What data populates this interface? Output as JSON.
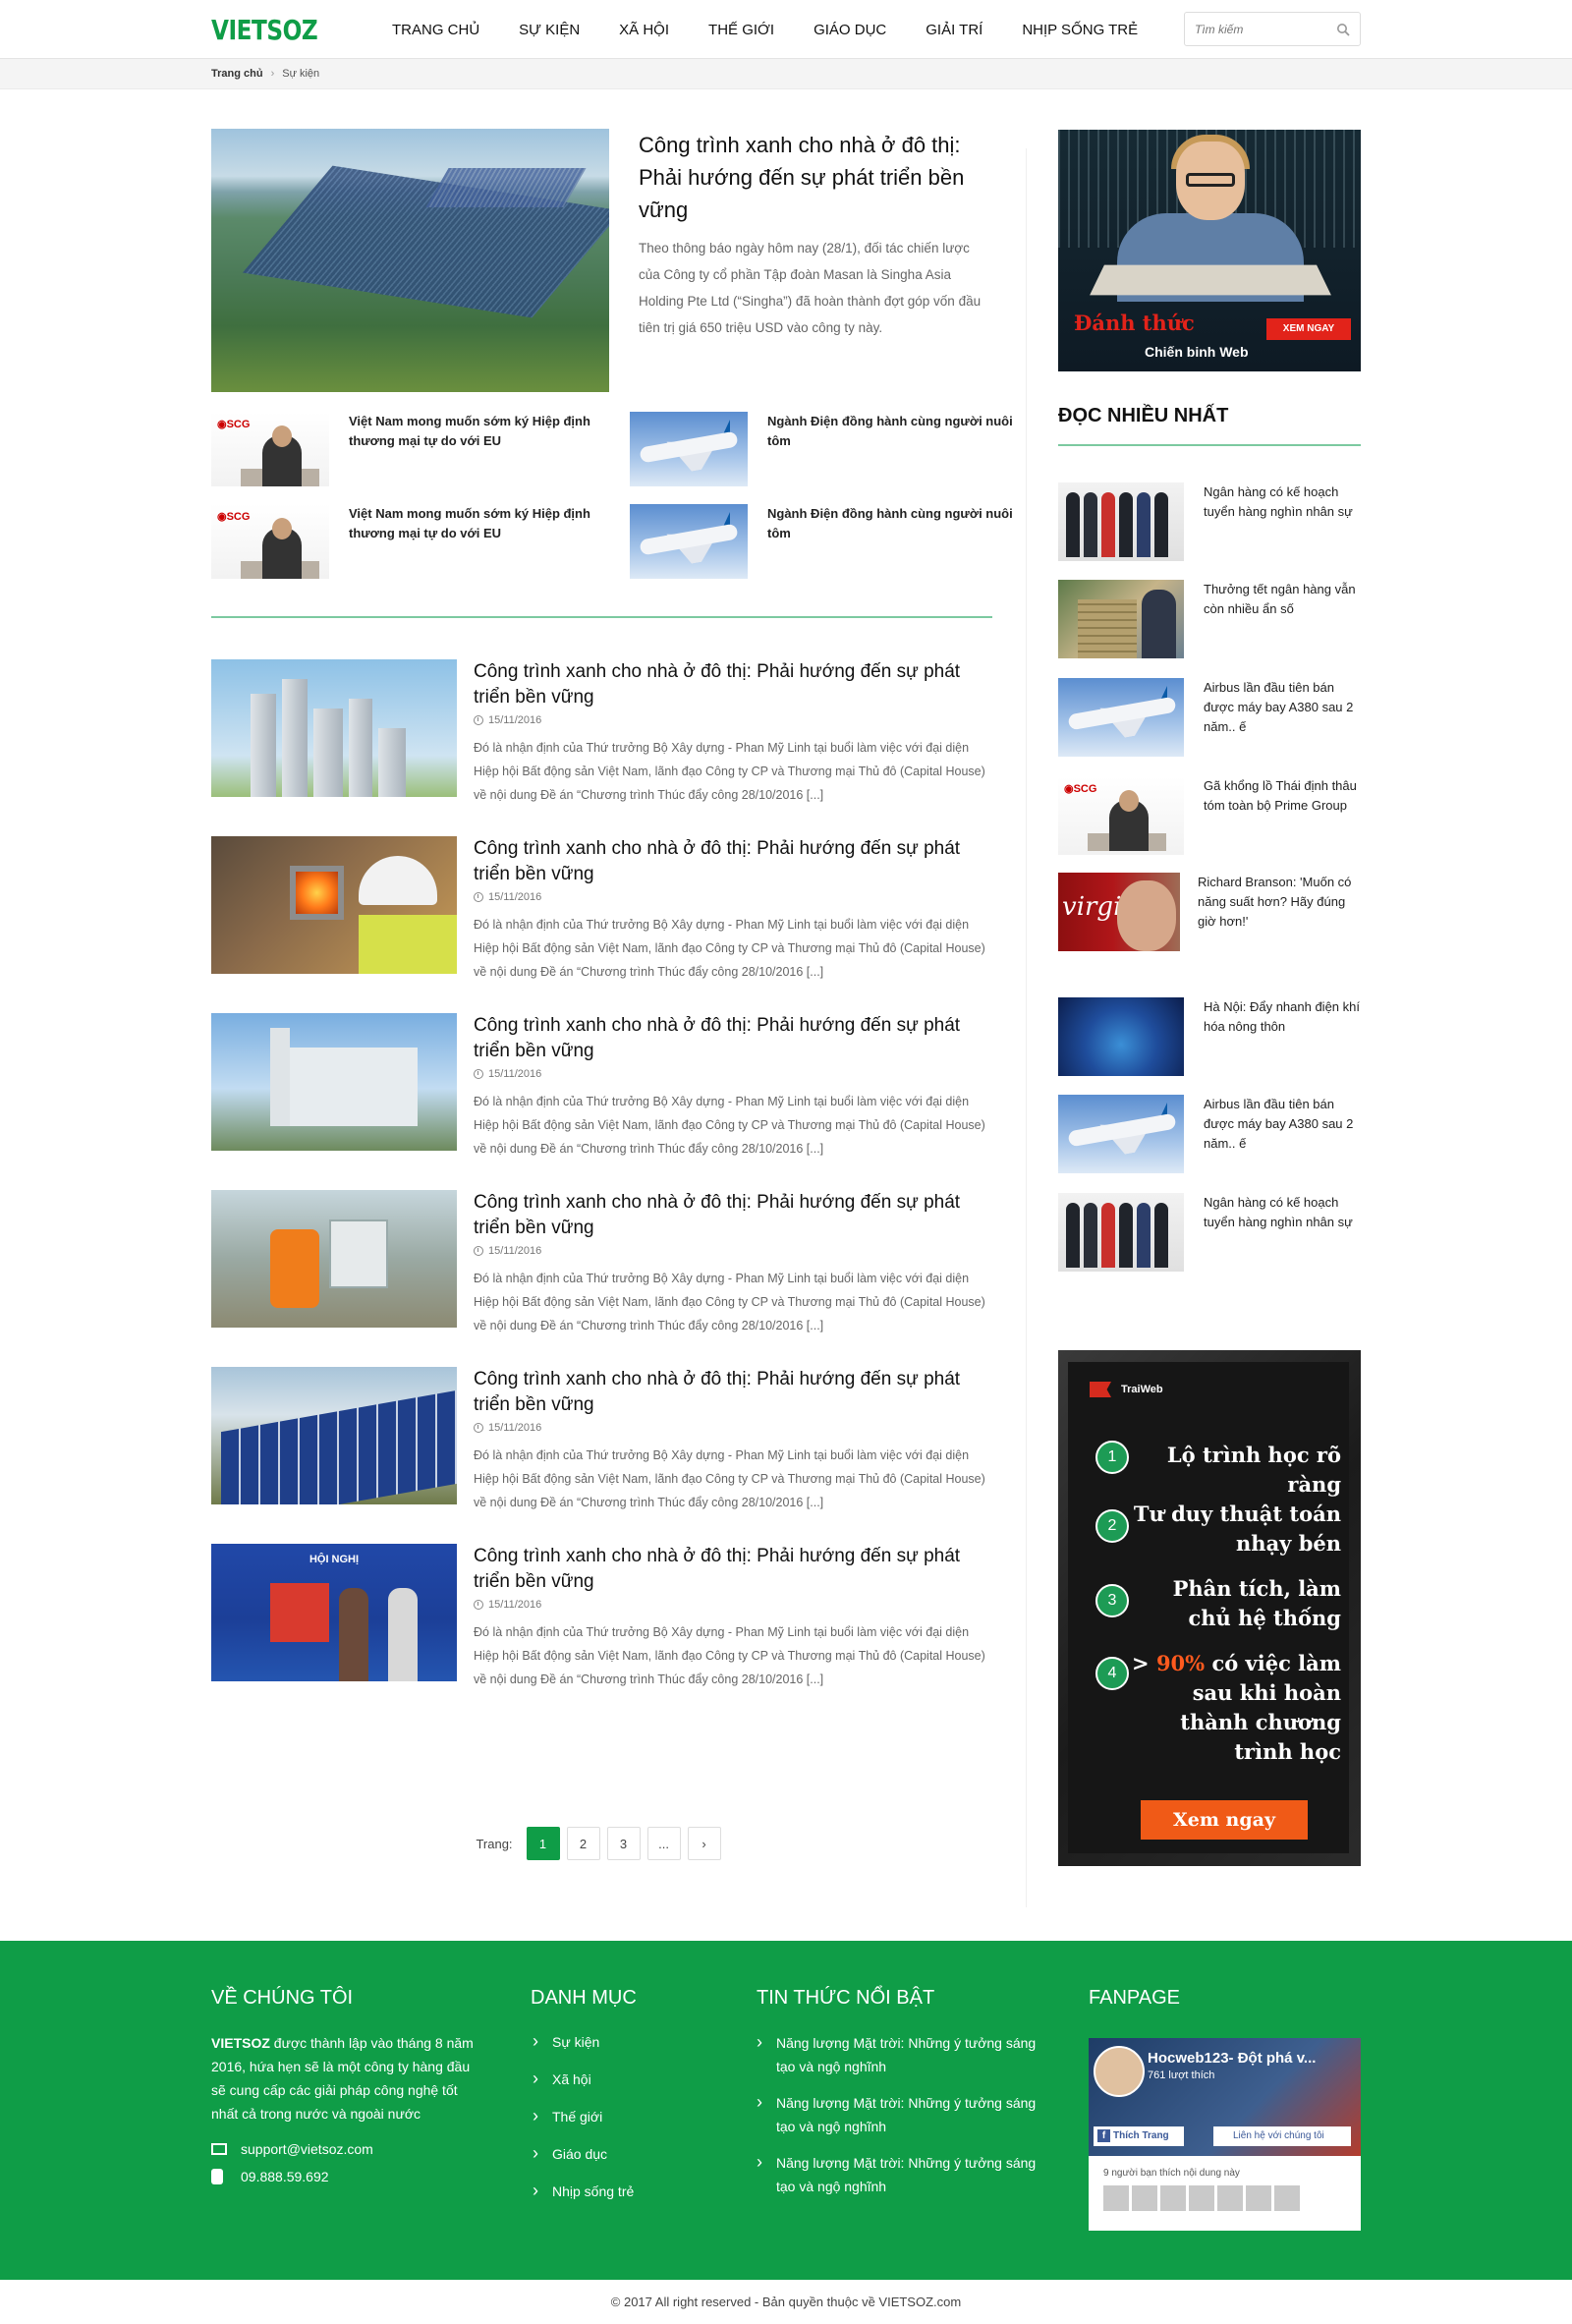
{
  "header": {
    "logo": "VIETSOZ",
    "nav": [
      "TRANG CHỦ",
      "SỰ KIỆN",
      "XÃ HỘI",
      "THẾ GIỚI",
      "GIÁO DỤC",
      "GIẢI TRÍ",
      "NHỊP SỐNG TRẺ"
    ],
    "search_placeholder": "Tìm kiếm"
  },
  "breadcrumb": {
    "home": "Trang chủ",
    "current": "Sự kiện"
  },
  "featured": {
    "title": "Công trình xanh cho nhà ở đô thị: Phải hướng đến sự phát triển bền vững",
    "desc": "Theo thông báo ngày hôm nay (28/1), đối tác chiến lược của Công ty cổ phần Tập đoàn Masan là Singha Asia Holding Pte Ltd (“Singha”) đã hoàn thành đợt góp vốn đầu tiên trị giá 650 triệu USD vào công ty này."
  },
  "small_news": [
    {
      "title": "Việt Nam mong muốn sớm ký Hiệp định thương mại tự do với EU",
      "thumb": "scg"
    },
    {
      "title": "Ngành Điện đồng hành cùng người nuôi tôm",
      "thumb": "plane"
    },
    {
      "title": "Việt Nam mong muốn sớm ký Hiệp định thương mại tự do với EU",
      "thumb": "scg"
    },
    {
      "title": "Ngành Điện đồng hành cùng người nuôi tôm",
      "thumb": "plane"
    }
  ],
  "articles": [
    {
      "title": "Công trình xanh cho nhà ở đô thị: Phải hướng đến sự phát triển bền vững",
      "date": "15/11/2016",
      "desc": "Đó là nhận định của Thứ trưởng Bộ Xây dựng - Phan Mỹ Linh tại buổi làm việc với đại diện Hiệp hội Bất động sản Việt Nam, lãnh đạo Công ty CP và Thương mại Thủ đô (Capital House) về nội dung Đề án “Chương trình Thúc đẩy công 28/10/2016 [...]"
    },
    {
      "title": "Công trình xanh cho nhà ở đô thị: Phải hướng đến sự phát triển bền vững",
      "date": "15/11/2016",
      "desc": "Đó là nhận định của Thứ trưởng Bộ Xây dựng - Phan Mỹ Linh tại buổi làm việc với đại diện Hiệp hội Bất động sản Việt Nam, lãnh đạo Công ty CP và Thương mại Thủ đô (Capital House) về nội dung Đề án “Chương trình Thúc đẩy công 28/10/2016 [...]"
    },
    {
      "title": "Công trình xanh cho nhà ở đô thị: Phải hướng đến sự phát triển bền vững",
      "date": "15/11/2016",
      "desc": "Đó là nhận định của Thứ trưởng Bộ Xây dựng - Phan Mỹ Linh tại buổi làm việc với đại diện Hiệp hội Bất động sản Việt Nam, lãnh đạo Công ty CP và Thương mại Thủ đô (Capital House) về nội dung Đề án “Chương trình Thúc đẩy công 28/10/2016 [...]"
    },
    {
      "title": "Công trình xanh cho nhà ở đô thị: Phải hướng đến sự phát triển bền vững",
      "date": "15/11/2016",
      "desc": "Đó là nhận định của Thứ trưởng Bộ Xây dựng - Phan Mỹ Linh tại buổi làm việc với đại diện Hiệp hội Bất động sản Việt Nam, lãnh đạo Công ty CP và Thương mại Thủ đô (Capital House) về nội dung Đề án “Chương trình Thúc đẩy công 28/10/2016 [...]"
    },
    {
      "title": "Công trình xanh cho nhà ở đô thị: Phải hướng đến sự phát triển bền vững",
      "date": "15/11/2016",
      "desc": "Đó là nhận định của Thứ trưởng Bộ Xây dựng - Phan Mỹ Linh tại buổi làm việc với đại diện Hiệp hội Bất động sản Việt Nam, lãnh đạo Công ty CP và Thương mại Thủ đô (Capital House) về nội dung Đề án “Chương trình Thúc đẩy công 28/10/2016 [...]"
    },
    {
      "title": "Công trình xanh cho nhà ở đô thị: Phải hướng đến sự phát triển bền vững",
      "date": "15/11/2016",
      "desc": "Đó là nhận định của Thứ trưởng Bộ Xây dựng - Phan Mỹ Linh tại buổi làm việc với đại diện Hiệp hội Bất động sản Việt Nam, lãnh đạo Công ty CP và Thương mại Thủ đô (Capital House) về nội dung Đề án “Chương trình Thúc đẩy công 28/10/2016 [...]"
    }
  ],
  "article_image_banner": "HỘI NGHỊ",
  "pagination": {
    "label": "Trang:",
    "pages": [
      "1",
      "2",
      "3",
      "...",
      "›"
    ],
    "active": "1"
  },
  "sidebar": {
    "ad_top": {
      "headline": "Đánh thức",
      "sub": "Chiến binh Web",
      "button": "XEM NGAY"
    },
    "popular_heading": "ĐỌC NHIỀU NHẤT",
    "popular": [
      {
        "title": "Ngân hàng có kế hoạch tuyển hàng nghìn nhân sự",
        "thumb": "people"
      },
      {
        "title": "Thưởng tết ngân hàng vẫn còn nhiều ẩn số",
        "thumb": "money"
      },
      {
        "title": "Airbus lần đầu tiên bán được máy bay A380 sau 2 năm.. ế",
        "thumb": "plane"
      },
      {
        "title": "Gã khổng lồ Thái định thâu tóm toàn bộ Prime Group",
        "thumb": "scg"
      },
      {
        "title": "Richard Branson: 'Muốn có năng suất hơn? Hãy đúng giờ hơn!'",
        "thumb": "virgin"
      },
      {
        "title": "Hà Nội: Đẩy nhanh điện khí hóa nông thôn",
        "thumb": "earth"
      },
      {
        "title": "Airbus lần đầu tiên bán được máy bay A380 sau 2 năm.. ế",
        "thumb": "plane"
      },
      {
        "title": "Ngân hàng có kế hoạch tuyển hàng nghìn nhân sự",
        "thumb": "people"
      }
    ],
    "ad_bottom": {
      "brand": "TraiWeb",
      "steps": [
        {
          "num": "1",
          "text": "Lộ trình học rõ ràng"
        },
        {
          "num": "2",
          "text": "Tư duy thuật toán nhạy bén"
        },
        {
          "num": "3",
          "text": "Phân tích, làm chủ hệ thống"
        },
        {
          "num": "4",
          "text_pre": ">",
          "highlight": "90%",
          "text": "có việc làm sau khi hoàn thành chương trình học"
        }
      ],
      "cta": "Xem ngay"
    }
  },
  "footer": {
    "about": {
      "heading": "VỀ CHÚNG TÔI",
      "brand": "VIETSOZ",
      "text": "được thành lập vào tháng 8 năm 2016, hứa hẹn sẽ là một công ty hàng đầu sẽ cung cấp các giải pháp công nghệ tốt nhất cả trong nước và ngoài nước",
      "email": "support@vietsoz.com",
      "phone": "09.888.59.692"
    },
    "categories": {
      "heading": "DANH MỤC",
      "items": [
        "Sự kiện",
        "Xã hội",
        "Thế giới",
        "Giáo dục",
        "Nhịp sống trẻ"
      ]
    },
    "news": {
      "heading": "TIN THỨC NỔI BẬT",
      "items": [
        "Năng lượng Mặt trời: Những ý tưởng sáng tạo và ngộ nghĩnh",
        "Năng lượng Mặt trời: Những ý tưởng sáng tạo và ngộ nghĩnh",
        "Năng lượng Mặt trời: Những ý tưởng sáng tạo và ngộ nghĩnh"
      ]
    },
    "fanpage": {
      "heading": "FANPAGE",
      "page_name": "Hocweb123- Đột phá v...",
      "likes": "761 lượt thích",
      "like_btn": "Thích Trang",
      "contact_btn": "Liên hệ với chúng tôi",
      "friends_text": "9 người bạn thích nội dung này"
    },
    "copyright": "© 2017 All right reserved - Bản quyền thuộc về VIETSOZ.com"
  },
  "colors": {
    "brand_green": "#0f9d47",
    "accent_line": "#7cc9a0"
  }
}
